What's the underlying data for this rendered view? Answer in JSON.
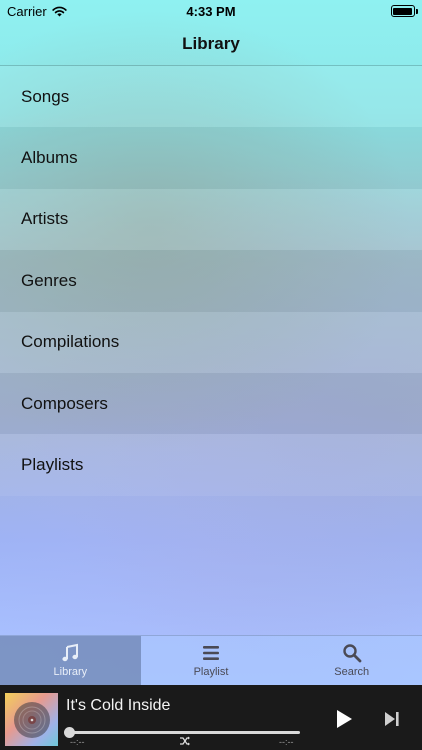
{
  "status_bar": {
    "carrier": "Carrier",
    "time": "4:33 PM"
  },
  "nav": {
    "title": "Library"
  },
  "library_items": [
    {
      "label": "Songs"
    },
    {
      "label": "Albums"
    },
    {
      "label": "Artists"
    },
    {
      "label": "Genres"
    },
    {
      "label": "Compilations"
    },
    {
      "label": "Composers"
    },
    {
      "label": "Playlists"
    }
  ],
  "tabs": [
    {
      "label": "Library",
      "icon": "music-note-icon",
      "active": true
    },
    {
      "label": "Playlist",
      "icon": "list-icon",
      "active": false
    },
    {
      "label": "Search",
      "icon": "search-icon",
      "active": false
    }
  ],
  "player": {
    "track_title": "It's Cold Inside",
    "elapsed": "--:--",
    "remaining": "--:--",
    "progress": 0
  }
}
